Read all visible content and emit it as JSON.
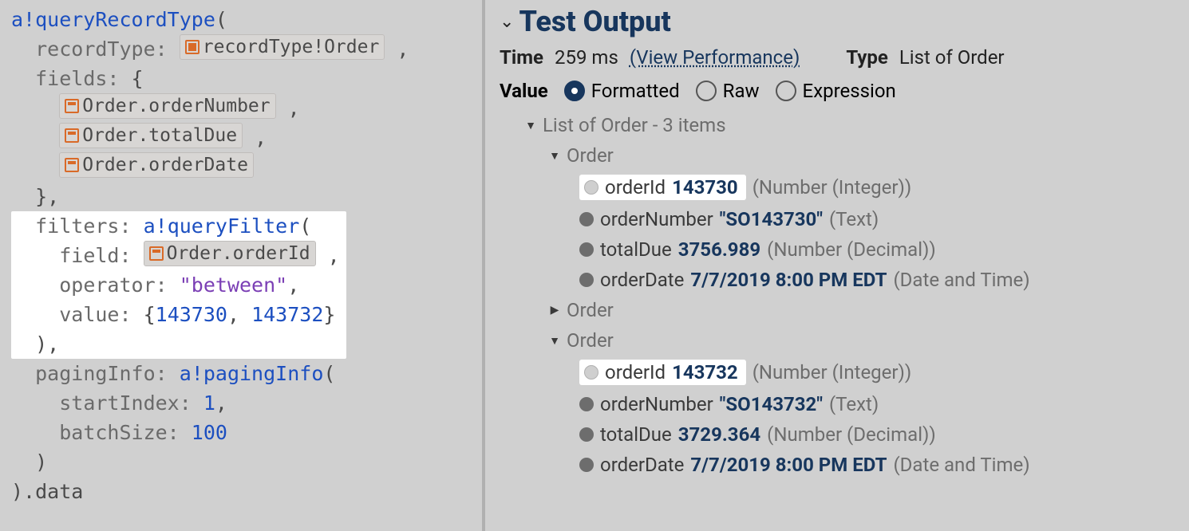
{
  "code": {
    "fn": "a!queryRecordType",
    "recordTypeLabel": "recordType:",
    "recordTypeChip": "recordType!Order",
    "fieldsLabel": "fields:",
    "fieldChips": [
      "Order.orderNumber",
      "Order.totalDue",
      "Order.orderDate"
    ],
    "filtersLabel": "filters:",
    "filterFn": "a!queryFilter",
    "filterFieldLabel": "field:",
    "filterFieldChip": "Order.orderId",
    "filterOperatorLabel": "operator:",
    "filterOperator": "\"between\"",
    "filterValueLabel": "value:",
    "filterValue1": "143730",
    "filterValue2": "143732",
    "pagingLabel": "pagingInfo:",
    "pagingFn": "a!pagingInfo",
    "startIndexLabel": "startIndex:",
    "startIndex": "1",
    "batchSizeLabel": "batchSize:",
    "batchSize": "100",
    "suffix": ").data"
  },
  "output": {
    "heading": "Test Output",
    "timeLabel": "Time",
    "timeValue": "259 ms",
    "perfLink": "(View Performance)",
    "typeLabel": "Type",
    "typeValue": "List of Order",
    "valueLabel": "Value",
    "radios": {
      "formatted": "Formatted",
      "raw": "Raw",
      "expression": "Expression"
    },
    "listLabel": "List of Order - 3 items",
    "orderLabel": "Order",
    "orders": [
      {
        "expanded": true,
        "fields": [
          {
            "name": "orderId",
            "value": "143730",
            "type": "(Number (Integer))",
            "highlight": true,
            "quoted": false
          },
          {
            "name": "orderNumber",
            "value": "\"SO143730\"",
            "type": "(Text)",
            "highlight": false,
            "quoted": true
          },
          {
            "name": "totalDue",
            "value": "3756.989",
            "type": "(Number (Decimal))",
            "highlight": false,
            "quoted": false
          },
          {
            "name": "orderDate",
            "value": "7/7/2019 8:00 PM EDT",
            "type": "(Date and Time)",
            "highlight": false,
            "quoted": false
          }
        ]
      },
      {
        "expanded": false,
        "fields": []
      },
      {
        "expanded": true,
        "fields": [
          {
            "name": "orderId",
            "value": "143732",
            "type": "(Number (Integer))",
            "highlight": true,
            "quoted": false
          },
          {
            "name": "orderNumber",
            "value": "\"SO143732\"",
            "type": "(Text)",
            "highlight": false,
            "quoted": true
          },
          {
            "name": "totalDue",
            "value": "3729.364",
            "type": "(Number (Decimal))",
            "highlight": false,
            "quoted": false
          },
          {
            "name": "orderDate",
            "value": "7/7/2019 8:00 PM EDT",
            "type": "(Date and Time)",
            "highlight": false,
            "quoted": false
          }
        ]
      }
    ]
  }
}
